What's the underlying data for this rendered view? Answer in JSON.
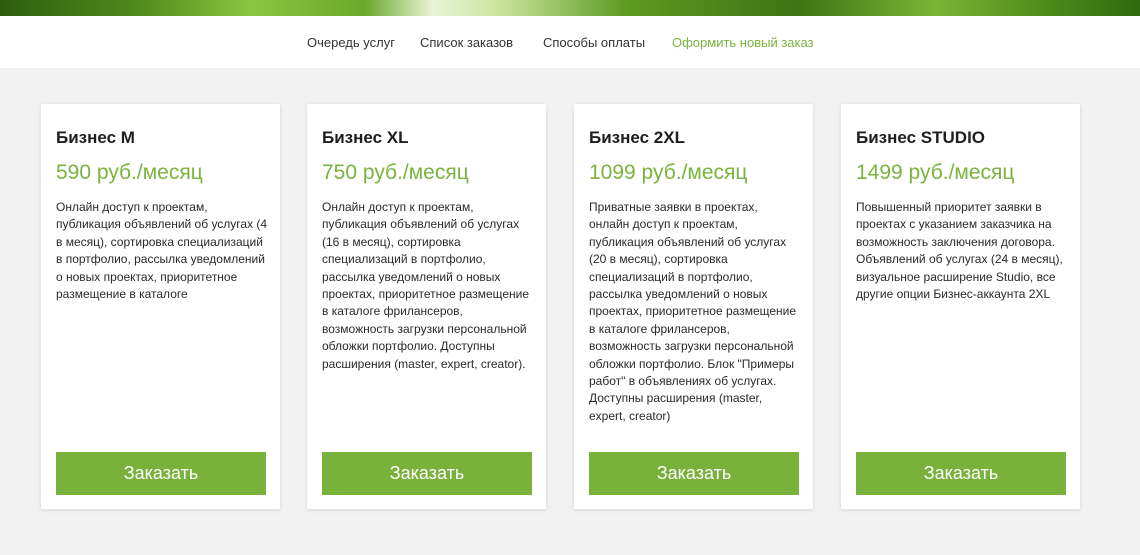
{
  "colors": {
    "accent": "#78b23b",
    "price": "#7ab33e",
    "background": "#f2f2f2"
  },
  "nav": {
    "items": [
      {
        "label": "Очередь услуг"
      },
      {
        "label": "Список заказов"
      },
      {
        "label": "Способы оплаты"
      },
      {
        "label": "Оформить новый заказ"
      }
    ],
    "active_item": "Оформить новый заказ"
  },
  "plans": [
    {
      "title": "Бизнес M",
      "price": "590 руб./месяц",
      "description": "Онлайн доступ к проектам, публикация объявлений об услугах (4 в месяц), сортировка специализаций в портфолио, рассылка уведомлений о новых проектах, приоритетное размещение в каталоге",
      "button_label": "Заказать"
    },
    {
      "title": "Бизнес XL",
      "price": "750 руб./месяц",
      "description": "Онлайн доступ к проектам, публикация объявлений об услугах (16 в месяц), сортировка специализаций в портфолио, рассылка уведомлений о новых проектах, приоритетное размещение в каталоге фрилансеров, возможность загрузки персональной обложки портфолио. Доступны расширения (master, expert, creator).",
      "button_label": "Заказать"
    },
    {
      "title": "Бизнес 2XL",
      "price": "1099 руб./месяц",
      "description": "Приватные заявки в проектах, онлайн доступ к проектам, публикация объявлений об услугах (20 в месяц), сортировка специализаций в портфолио, рассылка уведомлений о новых проектах, приоритетное размещение в каталоге фрилансеров, возможность загрузки персональной обложки портфолио. Блок \"Примеры работ\" в объявлениях об услугах. Доступны расширения (master, expert, creator)",
      "button_label": "Заказать"
    },
    {
      "title": "Бизнес STUDIO",
      "price": "1499 руб./месяц",
      "description": "Повышенный приоритет заявки в проектах с указанием заказчика на возможность заключения договора. Объявлений об услугах (24 в месяц), визуальное расширение Studio, все другие опции Бизнес-аккаунта 2XL",
      "button_label": "Заказать"
    }
  ]
}
